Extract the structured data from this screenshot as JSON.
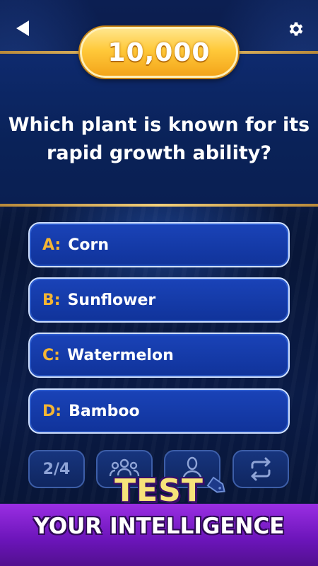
{
  "score": "10,000",
  "question": "Which plant is known for its rapid growth ability?",
  "answers": [
    {
      "letter": "A:",
      "text": "Corn"
    },
    {
      "letter": "B:",
      "text": "Sunflower"
    },
    {
      "letter": "C:",
      "text": "Watermelon"
    },
    {
      "letter": "D:",
      "text": "Bamboo"
    }
  ],
  "lifelines": {
    "fifty_fifty": "2/4",
    "audience_icon": "audience-icon",
    "phone_friend_icon": "person-icon",
    "swap_icon": "swap-question-icon"
  },
  "icons": {
    "back": "back-arrow-icon",
    "settings": "gear-icon",
    "tag": "price-tag-icon"
  },
  "promo": {
    "headline": "TEST",
    "subline": "YOUR INTELLIGENCE"
  },
  "colors": {
    "gold": "#f5b533",
    "answer_bg": "#1a43b8",
    "promo_purple": "#7a1fd0",
    "promo_yellow": "#f6e37a"
  }
}
